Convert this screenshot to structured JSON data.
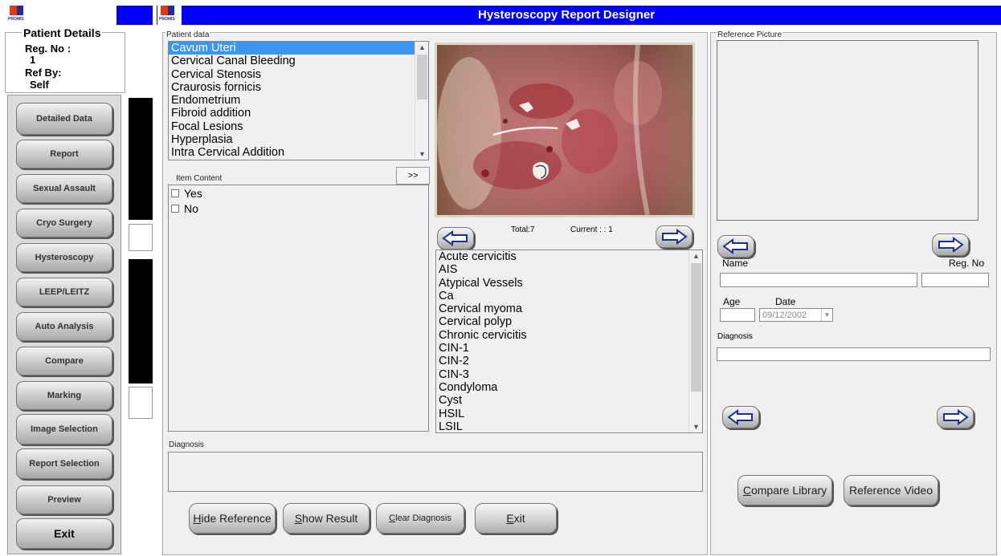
{
  "header": {
    "title": "Hysteroscopy Report Designer",
    "logo_text": "PROMIS"
  },
  "patient": {
    "heading": "Patient Details",
    "reg_label": "Reg. No :",
    "reg_value": "1",
    "ref_label": "Ref By:",
    "ref_value": "Self"
  },
  "nav": {
    "detailed_data": "Detailed Data",
    "report": "Report",
    "sexual_assault": "Sexual Assault",
    "cryo_surgery": "Cryo Surgery",
    "hysteroscopy": "Hysteroscopy",
    "leep": "LEEP/LEITZ",
    "auto_analysis": "Auto Analysis",
    "compare": "Compare",
    "marking": "Marking",
    "image_selection": "Image Selection",
    "report_selection": "Report Selection",
    "preview": "Preview",
    "exit": "Exit"
  },
  "patient_data": {
    "label": "Patient data",
    "items": [
      "Cavum Uteri",
      "Cervical Canal Bleeding",
      "Cervical Stenosis",
      "Craurosis fornicis",
      "Endometrium",
      "Fibroid addition",
      "Focal Lesions",
      "Hyperplasia",
      "Intra Cervical Addition"
    ],
    "selected": "Cavum Uteri"
  },
  "item_content": {
    "label": "Item Content",
    "expand_button": ">>",
    "options": [
      "Yes",
      "No"
    ]
  },
  "image_viewer": {
    "total": "Total:7",
    "current": "Current : : 1"
  },
  "findings": {
    "items": [
      "Acute cervicitis",
      "AIS",
      "Atypical Vessels",
      "Ca",
      "Cervical myoma",
      "Cervical polyp",
      "Chronic cervicitis",
      "CIN-1",
      "CIN-2",
      "CIN-3",
      "Condyloma",
      "Cyst",
      "HSIL",
      "LSIL"
    ]
  },
  "diagnosis": {
    "label": "Diagnosis",
    "value": ""
  },
  "actions": {
    "hide_reference": "Hide Reference",
    "show_result": "Show Result",
    "clear_diagnosis": "Clear Diagnosis",
    "exit": "Exit"
  },
  "reference": {
    "label": "Reference Picture",
    "name_label": "Name",
    "reg_label": "Reg. No",
    "age_label": "Age",
    "date_label": "Date",
    "date_value": "09/12/2002",
    "diagnosis_label": "Diagnosis",
    "compare_library": "Compare Library",
    "reference_video": "Reference Video"
  },
  "colors": {
    "title_bar": "#0000ff",
    "selection": "#3d95f2",
    "panel_bg": "#f0f0f0"
  }
}
